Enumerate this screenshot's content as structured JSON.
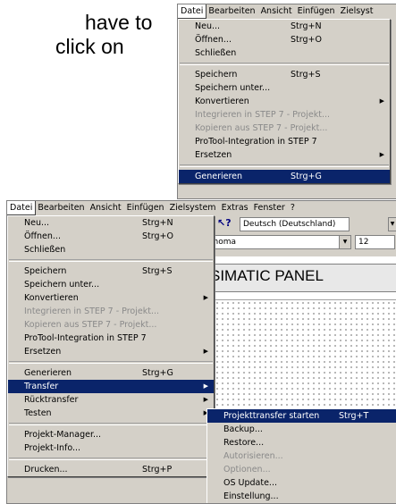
{
  "document": {
    "line1": "have to",
    "line2": "click on"
  },
  "menubar": [
    "Datei",
    "Bearbeiten",
    "Ansicht",
    "Einfügen",
    "Zielsystem",
    "Extras",
    "Fenster",
    "?"
  ],
  "menubar_top": [
    "Datei",
    "Bearbeiten",
    "Ansicht",
    "Einfügen",
    "Zielsyst"
  ],
  "file_menu_top": [
    {
      "label": "Neu...",
      "shortcut": "Strg+N",
      "state": "normal"
    },
    {
      "label": "Öffnen...",
      "shortcut": "Strg+O",
      "state": "normal"
    },
    {
      "label": "Schließen",
      "shortcut": "",
      "state": "normal"
    },
    {
      "sep": true
    },
    {
      "label": "Speichern",
      "shortcut": "Strg+S",
      "state": "normal"
    },
    {
      "label": "Speichern unter...",
      "shortcut": "",
      "state": "normal"
    },
    {
      "label": "Konvertieren",
      "shortcut": "",
      "state": "normal",
      "submenu": true
    },
    {
      "label": "Integrieren in STEP 7 - Projekt...",
      "shortcut": "",
      "state": "disabled"
    },
    {
      "label": "Kopieren aus STEP 7 - Projekt...",
      "shortcut": "",
      "state": "disabled"
    },
    {
      "label": "ProTool-Integration in STEP 7",
      "shortcut": "",
      "state": "normal"
    },
    {
      "label": "Ersetzen",
      "shortcut": "",
      "state": "normal",
      "submenu": true
    },
    {
      "sep": true
    },
    {
      "label": "Generieren",
      "shortcut": "Strg+G",
      "state": "highlight"
    }
  ],
  "file_menu_main": [
    {
      "label": "Neu...",
      "shortcut": "Strg+N",
      "state": "normal"
    },
    {
      "label": "Öffnen...",
      "shortcut": "Strg+O",
      "state": "normal"
    },
    {
      "label": "Schließen",
      "shortcut": "",
      "state": "normal"
    },
    {
      "sep": true
    },
    {
      "label": "Speichern",
      "shortcut": "Strg+S",
      "state": "normal"
    },
    {
      "label": "Speichern unter...",
      "shortcut": "",
      "state": "normal"
    },
    {
      "label": "Konvertieren",
      "shortcut": "",
      "state": "normal",
      "submenu": true
    },
    {
      "label": "Integrieren in STEP 7 - Projekt...",
      "shortcut": "",
      "state": "disabled"
    },
    {
      "label": "Kopieren aus STEP 7 - Projekt...",
      "shortcut": "",
      "state": "disabled"
    },
    {
      "label": "ProTool-Integration in STEP 7",
      "shortcut": "",
      "state": "normal"
    },
    {
      "label": "Ersetzen",
      "shortcut": "",
      "state": "normal",
      "submenu": true
    },
    {
      "sep": true
    },
    {
      "label": "Generieren",
      "shortcut": "Strg+G",
      "state": "normal"
    },
    {
      "label": "Transfer",
      "shortcut": "",
      "state": "highlight",
      "submenu": true
    },
    {
      "label": "Rücktransfer",
      "shortcut": "",
      "state": "normal",
      "submenu": true
    },
    {
      "label": "Testen",
      "shortcut": "",
      "state": "normal",
      "submenu": true
    },
    {
      "sep": true
    },
    {
      "label": "Projekt-Manager...",
      "shortcut": "",
      "state": "normal"
    },
    {
      "label": "Projekt-Info...",
      "shortcut": "",
      "state": "normal"
    },
    {
      "sep": true
    },
    {
      "label": "Drucken...",
      "shortcut": "Strg+P",
      "state": "normal"
    }
  ],
  "transfer_menu": [
    {
      "label": "Projekttransfer starten",
      "shortcut": "Strg+T",
      "state": "highlight"
    },
    {
      "label": "Backup...",
      "shortcut": "",
      "state": "normal"
    },
    {
      "label": "Restore...",
      "shortcut": "",
      "state": "normal"
    },
    {
      "label": "Autorisieren...",
      "shortcut": "",
      "state": "disabled"
    },
    {
      "label": "Optionen...",
      "shortcut": "",
      "state": "disabled"
    },
    {
      "label": "OS Update...",
      "shortcut": "",
      "state": "normal"
    },
    {
      "label": "Einstellung...",
      "shortcut": "",
      "state": "normal"
    }
  ],
  "toolbar": {
    "language": "Deutsch (Deutschland)",
    "font": "Tahoma",
    "font_size": "12"
  },
  "panel_title": "SIMATIC PANEL",
  "colors": {
    "menu_bg": "#d4d0c8",
    "highlight": "#0a246a",
    "disabled": "#8a8a8a"
  }
}
